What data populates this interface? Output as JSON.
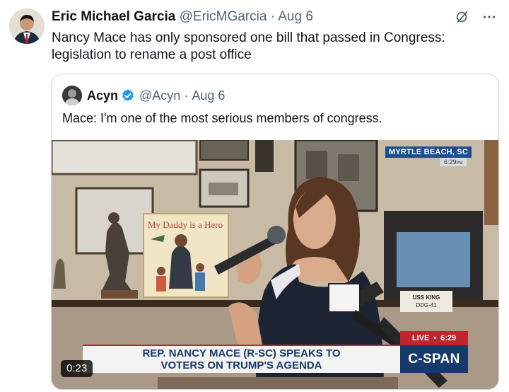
{
  "tweet": {
    "author_name": "Eric Michael Garcia",
    "author_handle": "@EricMGarcia",
    "separator": "·",
    "date": "Aug 6",
    "text": "Nancy Mace has only sponsored one bill that passed in Congress: legislation to rename a post office",
    "icons": [
      "grok-icon",
      "more-icon"
    ]
  },
  "quote": {
    "author_name": "Acyn",
    "author_handle": "@Acyn",
    "verified_icon": "verified-badge-icon",
    "date": "Aug 6",
    "text": "Mace: I'm one of the most serious members of congress.",
    "video": {
      "location": "MYRTLE BEACH, SC",
      "time": "6:29",
      "time_suffix": "PM",
      "book_title": "My Daddy is a Hero",
      "plaque_line1": "USS KING",
      "plaque_line2": "DDG-41",
      "chyron": "REP. NANCY MACE (R-SC) SPEAKS TO VOTERS ON TRUMP'S AGENDA",
      "live_label": "LIVE",
      "live_dot": "•",
      "live_time": "6:29",
      "network": "C-SPAN",
      "duration": "0:23"
    }
  },
  "colors": {
    "text": "#0f1419",
    "muted": "#536471",
    "verified": "#1d9bf0",
    "border": "#cfd9de",
    "cspan_blue": "#173a6a",
    "live_red": "#c0252d"
  }
}
